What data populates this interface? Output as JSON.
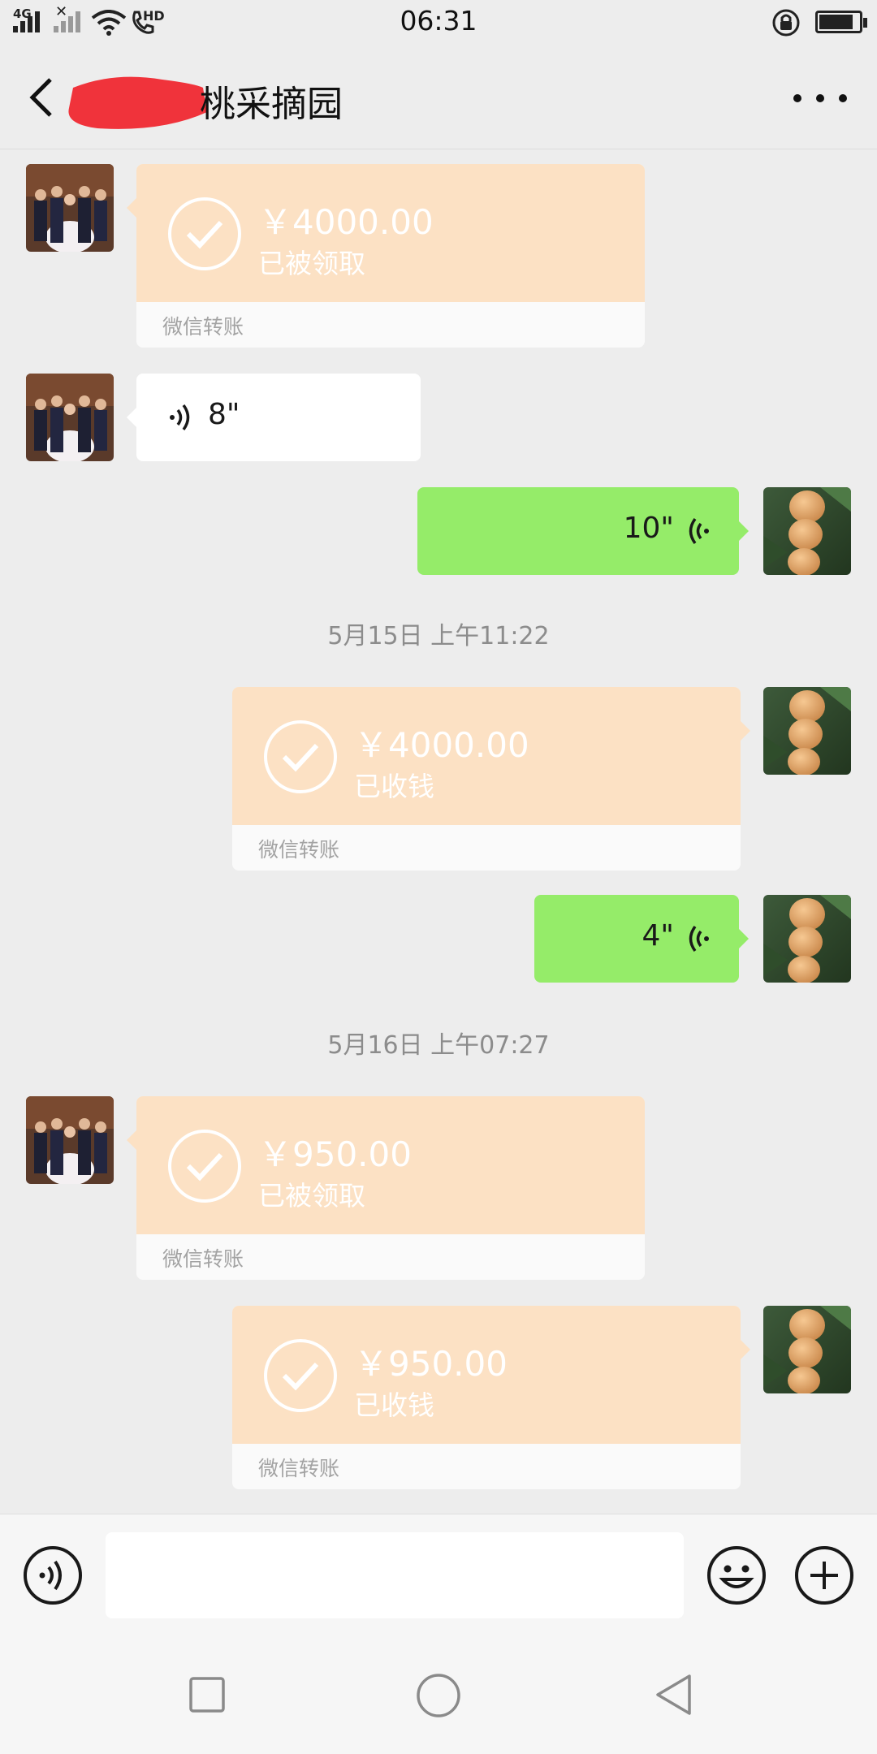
{
  "status_bar": {
    "network": "4G",
    "call_label": "HD",
    "time": "06:31",
    "battery_level_percent": 85
  },
  "header": {
    "title_visible": "桃采摘园",
    "back_icon": "chevron-left-icon",
    "more_icon": "more-dots-icon"
  },
  "messages": [
    {
      "type": "transfer",
      "side": "left",
      "amount": "￥4000.00",
      "status": "已被领取",
      "footer": "微信转账"
    },
    {
      "type": "voice",
      "side": "left",
      "duration": "8\""
    },
    {
      "type": "voice",
      "side": "right",
      "duration": "10\""
    },
    {
      "type": "time",
      "text": "5月15日 上午11:22"
    },
    {
      "type": "transfer",
      "side": "right",
      "amount": "￥4000.00",
      "status": "已收钱",
      "footer": "微信转账"
    },
    {
      "type": "voice",
      "side": "right",
      "duration": "4\""
    },
    {
      "type": "time",
      "text": "5月16日 上午07:27"
    },
    {
      "type": "transfer",
      "side": "left",
      "amount": "￥950.00",
      "status": "已被领取",
      "footer": "微信转账"
    },
    {
      "type": "transfer",
      "side": "right",
      "amount": "￥950.00",
      "status": "已收钱",
      "footer": "微信转账"
    }
  ],
  "input_bar": {
    "voice_icon": "voice-mode-icon",
    "text_value": "",
    "emoji_icon": "emoji-icon",
    "plus_icon": "plus-icon"
  },
  "nav_bar": {
    "recent_icon": "square-icon",
    "home_icon": "circle-icon",
    "back_icon": "triangle-back-icon"
  },
  "colors": {
    "background": "#ededed",
    "transfer_top": "#fce1c4",
    "voice_sent": "#95ec69",
    "voice_received": "#ffffff",
    "redaction": "#f0333b"
  }
}
